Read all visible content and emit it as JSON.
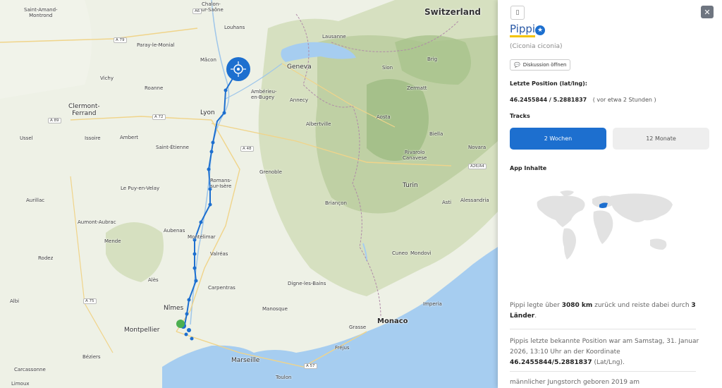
{
  "map": {
    "labels": {
      "saint_amand": "Saint-Amand-\nMontrond",
      "chalon": "Chalon-\nsur-Saône",
      "switzerland": "Switzerland",
      "louhans": "Louhans",
      "paray": "Paray-le-Monial",
      "lausanne": "Lausanne",
      "vichy": "Vichy",
      "macon": "Mâcon",
      "geneva": "Geneva",
      "sion": "Sion",
      "brig": "Brig",
      "roanne": "Roanne",
      "amberieu": "Ambérieu-\nen-Bugey",
      "zermatt": "Zermatt",
      "clermont": "Clermont-\nFerrand",
      "lyon": "Lyon",
      "annecy": "Annecy",
      "aosta": "Aosta",
      "albertville": "Albertville",
      "ussel": "Ussel",
      "issoire": "Issoire",
      "ambert": "Ambert",
      "biella": "Biella",
      "saint_etienne": "Saint-Étienne",
      "novara": "Novara",
      "rivarolo": "Rivarolo\nCanavese",
      "grenoble": "Grenoble",
      "romans": "Romans-\nsur-Isère",
      "le_puy": "Le Puy-en-Velay",
      "turin": "Turin",
      "aurillac": "Aurillac",
      "briancon": "Briançon",
      "asti": "Asti",
      "alessandria": "Alessandria",
      "aumont": "Aumont-Aubrac",
      "aubenas": "Aubenas",
      "montelimar": "Montélimar",
      "mende": "Mende",
      "cuneo": "Cuneo",
      "mondovi": "Mondovì",
      "rodez": "Rodez",
      "valreas": "Valréas",
      "ales": "Alès",
      "carpentras": "Carpentras",
      "digne": "Digne-les-Bains",
      "albi": "Albi",
      "imperia": "Imperia",
      "nimes": "Nîmes",
      "manosque": "Manosque",
      "monaco": "Monaco",
      "grasse": "Grasse",
      "montpellier": "Montpellier",
      "frejus": "Fréjus",
      "beziers": "Béziers",
      "marseille": "Marseille",
      "carcassonne": "Carcassonne",
      "toulon": "Toulon",
      "limoux": "Limoux"
    },
    "roads": {
      "a79": "A 79",
      "a72": "A 72",
      "a89": "A 89",
      "a48": "A 48",
      "a26": "A26/A4",
      "a75": "A 75",
      "a57": "A 57",
      "a6": "A6"
    },
    "colors": {
      "track": "#1d6fcf",
      "start": "#4caf50",
      "sea": "#a6cdf0"
    }
  },
  "panel": {
    "edit_icon": "edit-icon",
    "close_icon": "close-icon",
    "name": "Pippi",
    "verified_icon": "star-badge-icon",
    "latin": "(Ciconia ciconia)",
    "discussion_label": "Diskussion öffnen",
    "position_heading": "Letzte Position (lat/lng):",
    "position_value": "46.2455844 / 5.2881837",
    "position_ago": "( vor etwa 2 Stunden )",
    "tracks_heading": "Tracks",
    "tab_active": "2 Wochen",
    "tab_inactive": "12 Monate",
    "app_heading": "App Inhalte",
    "summary": {
      "prefix": "Pippi legte über ",
      "distance": "3080 km",
      "mid": " zurück und reiste dabei durch ",
      "countries": "3 Länder",
      "suffix": "."
    },
    "last_position": {
      "prefix": "Pippis letzte bekannte Position war am Samstag, 31. Januar 2026, 13:10 Uhr an der Koordinate ",
      "coord": "46.2455844/5.2881837",
      "suffix": " (Lat/Lng)."
    },
    "born_text": "männlicher Jungstorch geboren 2019 am"
  }
}
